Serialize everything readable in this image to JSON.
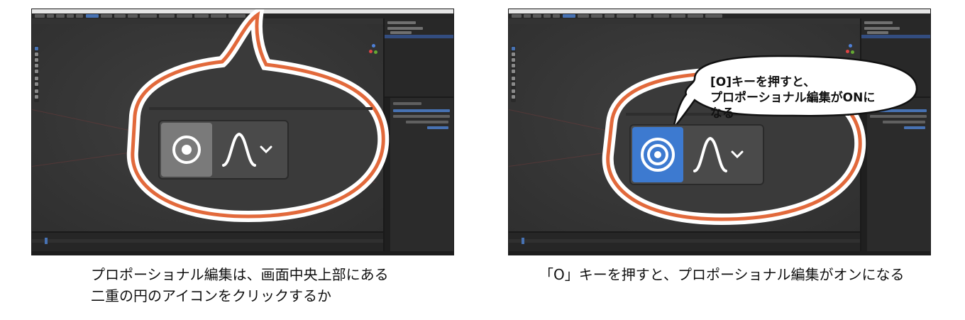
{
  "left": {
    "caption_line1": "プロポーショナル編集は、画面中央上部にある",
    "caption_line2": "二重の円のアイコンをクリックするか",
    "toggle_state": "off",
    "icon": "proportional-editing-off-icon",
    "falloff_icon": "falloff-curve-icon",
    "dropdown_icon": "chevron-down-icon"
  },
  "right": {
    "caption": "「O」キーを押すと、プロポーショナル編集がオンになる",
    "callout_line1": "[O]キーを押すと、",
    "callout_line2": "プロポーショナル編集がONになる",
    "toggle_state": "on",
    "icon": "proportional-editing-on-icon",
    "falloff_icon": "falloff-curve-icon",
    "dropdown_icon": "chevron-down-icon"
  },
  "colors": {
    "bubble_outline": "#e2693b",
    "toggle_active": "#3d7ad0",
    "toggle_inactive": "#7a7a7a",
    "blender_bg": "#2b2b2b",
    "blender_accent": "#4772b3"
  }
}
